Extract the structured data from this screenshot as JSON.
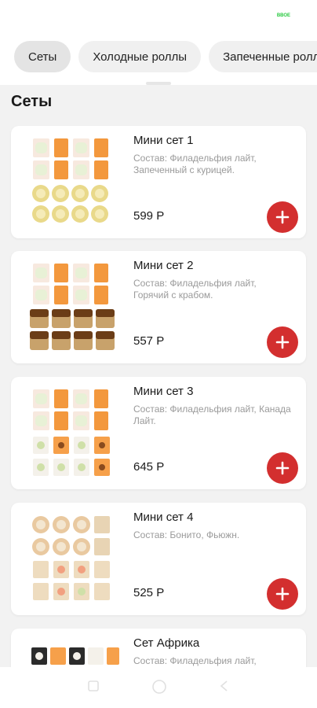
{
  "status_bar": {
    "battery_label": "ВВОЕ"
  },
  "categories": [
    {
      "label": "Сеты"
    },
    {
      "label": "Холодные роллы"
    },
    {
      "label": "Запеченные роллы"
    }
  ],
  "section": {
    "title": "Сеты"
  },
  "products": [
    {
      "name": "Мини сет 1",
      "description": "Состав: Филадельфия лайт, Запеченный с курицей.",
      "price": "599 Р"
    },
    {
      "name": "Мини сет 2",
      "description": "Состав: Филадельфия лайт, Горячий с крабом.",
      "price": "557 Р"
    },
    {
      "name": "Мини сет 3",
      "description": "Состав: Филадельфия лайт, Канада Лайт.",
      "price": "645 Р"
    },
    {
      "name": "Мини сет 4",
      "description": "Состав: Бонито, Фьюжн.",
      "price": "525 Р"
    },
    {
      "name": "Сет Африка",
      "description": "Состав: Филадельфия лайт,",
      "price": ""
    }
  ],
  "navigation": [
    "back-icon",
    "home-icon",
    "recents-icon"
  ],
  "colors": {
    "accent": "#d32f2f",
    "background": "#f2f2f2",
    "card": "#ffffff",
    "chip": "#f0f0f0",
    "muted_text": "#9a9a9a"
  }
}
